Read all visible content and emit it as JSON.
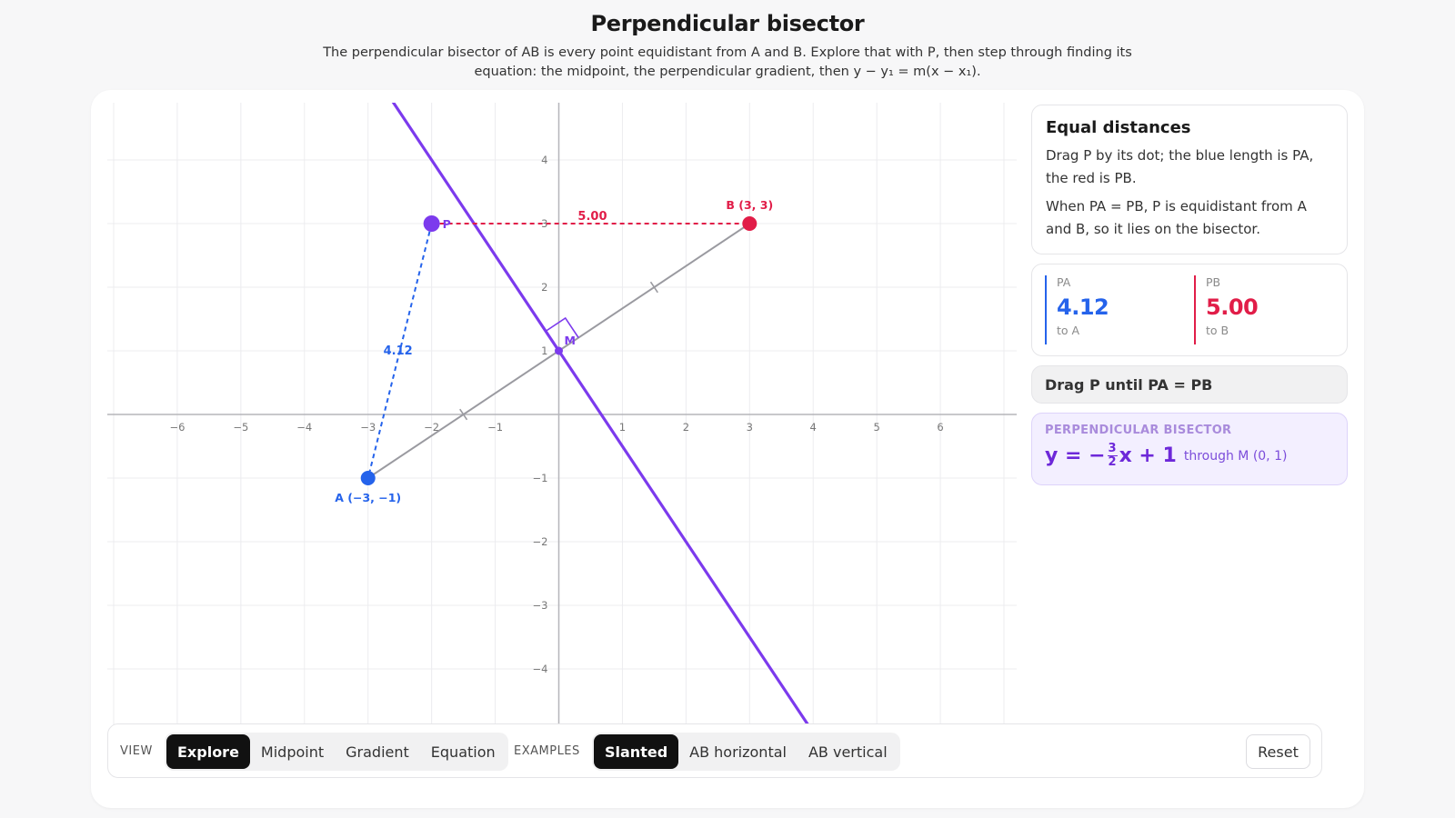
{
  "header": {
    "title": "Perpendicular bisector",
    "subtitle": "The perpendicular bisector of AB is every point equidistant from A and B. Explore that with P, then step through finding its equation: the midpoint, the perpendicular gradient, then y − y₁ = m(x − x₁)."
  },
  "diagram": {
    "x_ticks": [
      -6,
      -5,
      -4,
      -3,
      -2,
      -1,
      1,
      2,
      3,
      4,
      5,
      6
    ],
    "y_ticks": [
      -4,
      -3,
      -2,
      -1,
      1,
      2,
      3,
      4
    ],
    "x_tick_labels": [
      "−6",
      "−5",
      "−4",
      "−3",
      "−2",
      "−1",
      "1",
      "2",
      "3",
      "4",
      "5",
      "6"
    ],
    "y_tick_labels": [
      "−4",
      "−3",
      "−2",
      "−1",
      "1",
      "2",
      "3",
      "4"
    ],
    "xlim": [
      -7.1,
      7.2
    ],
    "ylim": [
      -4.9,
      4.9
    ],
    "points": {
      "A": {
        "x": -3,
        "y": -1,
        "label": "A (−3, −1)"
      },
      "B": {
        "x": 3,
        "y": 3,
        "label": "B (3, 3)"
      },
      "P": {
        "x": -2,
        "y": 3,
        "label": "P"
      },
      "M": {
        "x": 0,
        "y": 1,
        "label": "M"
      }
    },
    "bisector_gradient": -1.5,
    "bisector_intercept": 1,
    "pa_label": "4.12",
    "pb_label": "5.00",
    "colors": {
      "a": "#2563eb",
      "b": "#e11d48",
      "p": "#7c3aed",
      "bisector": "#7c3aed",
      "segment": "#9a9aa0",
      "grid": "#ececef",
      "axis": "#b5b5ba"
    }
  },
  "info": {
    "title": "Equal distances",
    "line1": "Drag P by its dot; the blue length is PA, the red is PB.",
    "line2": "When PA = PB, P is equidistant from A and B, so it lies on the bisector."
  },
  "distances": {
    "pa": {
      "label": "PA",
      "value": "4.12",
      "sub": "to A"
    },
    "pb": {
      "label": "PB",
      "value": "5.00",
      "sub": "to B"
    }
  },
  "status": "Drag P until PA = PB",
  "bisector": {
    "label": "PERPENDICULAR BISECTOR",
    "eq_start": "y = −",
    "frac_num": "3",
    "frac_den": "2",
    "eq_end": "x + 1",
    "through": "through M (0, 1)"
  },
  "toolbar": {
    "view_label": "VIEW",
    "views": [
      "Explore",
      "Midpoint",
      "Gradient",
      "Equation"
    ],
    "active_view": "Explore",
    "examples_label": "EXAMPLES",
    "examples": [
      "Slanted",
      "AB horizontal",
      "AB vertical"
    ],
    "active_example": "Slanted",
    "reset_label": "Reset"
  }
}
